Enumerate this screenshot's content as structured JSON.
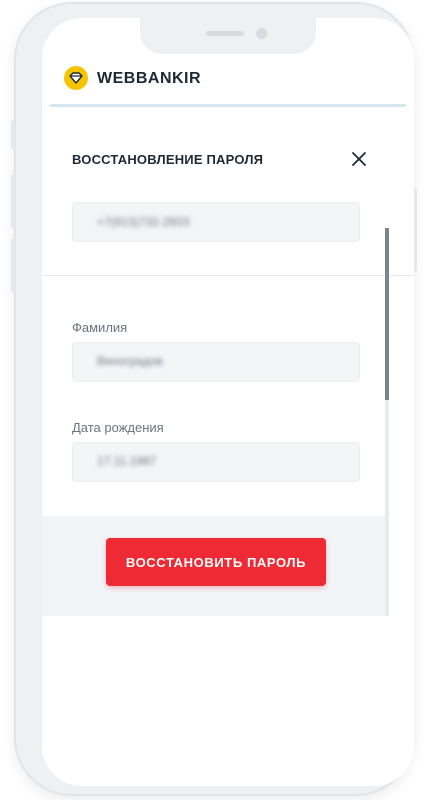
{
  "app": {
    "brand_name": "WEBBANKIR",
    "brand_color": "#f5c400"
  },
  "modal": {
    "title": "ВОССТАНОВЛЕНИЕ ПАРОЛЯ",
    "close_icon": "close-icon",
    "phone_value": "+7(913)732-2933",
    "fields": [
      {
        "label": "Фамилия",
        "value": "Виноградов"
      },
      {
        "label": "Дата рождения",
        "value": "17.11.1987"
      }
    ],
    "submit_label": "ВОССТАНОВИТЬ ПАРОЛЬ"
  },
  "colors": {
    "accent": "#ee2b35",
    "text_dark": "#1d2a36",
    "field_bg": "#f3f5f7"
  }
}
